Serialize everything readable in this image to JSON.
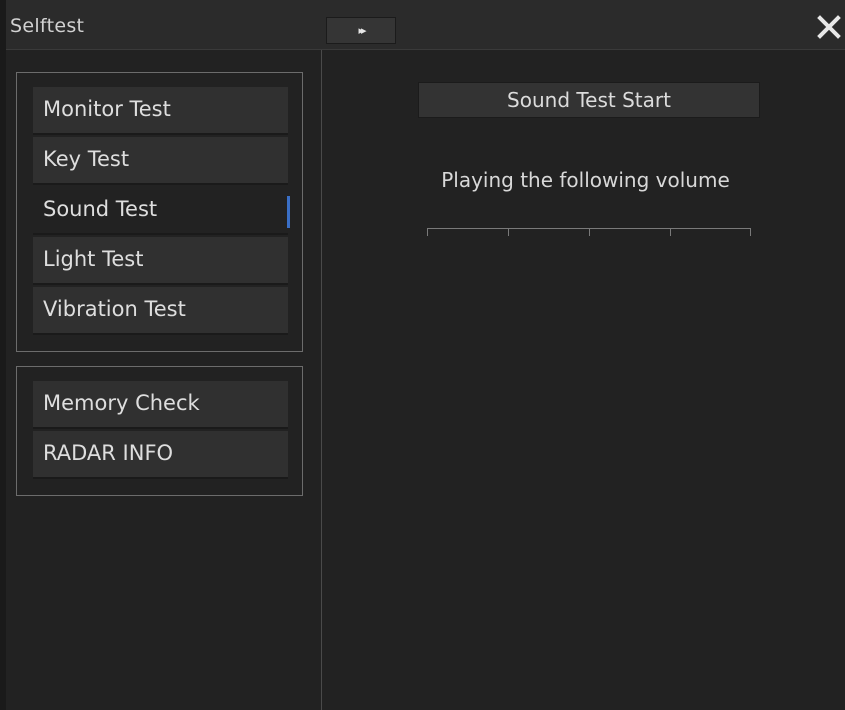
{
  "window": {
    "title": "Selftest",
    "expand_icon": "double-chevron-right-icon",
    "expand_glyph": "▸▸",
    "close_icon": "close-icon"
  },
  "sidebar": {
    "group1": [
      {
        "label": "Monitor Test",
        "selected": false
      },
      {
        "label": "Key Test",
        "selected": false
      },
      {
        "label": "Sound Test",
        "selected": true
      },
      {
        "label": "Light Test",
        "selected": false
      },
      {
        "label": "Vibration Test",
        "selected": false
      }
    ],
    "group2": [
      {
        "label": "Memory Check"
      },
      {
        "label": "RADAR INFO"
      }
    ]
  },
  "main": {
    "start_button_label": "Sound Test Start",
    "status_text": "Playing the following volume",
    "volume_scale_segments": 4
  },
  "colors": {
    "background": "#222222",
    "selection_indicator": "#3a6fc6",
    "button": "#303030"
  }
}
